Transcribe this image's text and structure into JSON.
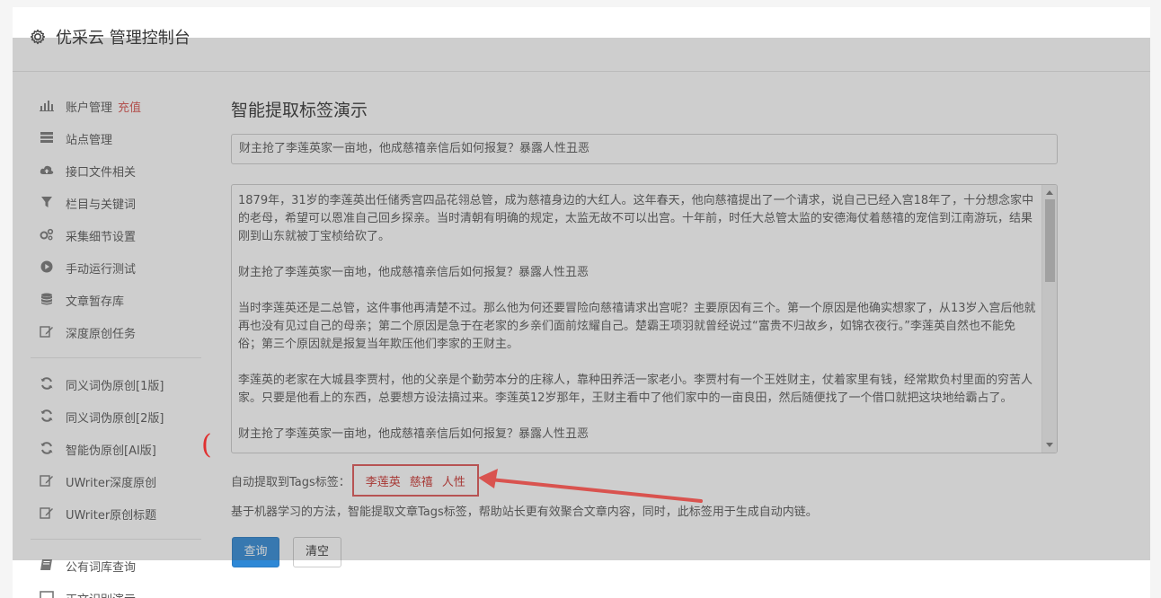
{
  "header": {
    "title": "优采云 管理控制台"
  },
  "sidebar": {
    "items": [
      {
        "label": "账户管理",
        "badge": "充值",
        "icon": "bar-chart-icon"
      },
      {
        "label": "站点管理",
        "icon": "server-icon"
      },
      {
        "label": "接口文件相关",
        "icon": "cloud-upload-icon"
      },
      {
        "label": "栏目与关键词",
        "icon": "filter-icon"
      },
      {
        "label": "采集细节设置",
        "icon": "cogs-icon"
      },
      {
        "label": "手动运行测试",
        "icon": "play-circle-icon"
      },
      {
        "label": "文章暂存库",
        "icon": "database-icon"
      },
      {
        "label": "深度原创任务",
        "icon": "edit-icon"
      }
    ],
    "items2": [
      {
        "label": "同义词伪原创[1版]",
        "icon": "refresh-icon"
      },
      {
        "label": "同义词伪原创[2版]",
        "icon": "refresh-icon"
      },
      {
        "label": "智能伪原创[AI版]",
        "icon": "refresh-icon"
      },
      {
        "label": "UWriter深度原创",
        "icon": "edit-icon"
      },
      {
        "label": "UWriter原创标题",
        "icon": "edit-icon"
      }
    ],
    "items3": [
      {
        "label": "公有词库查询",
        "icon": "book-icon"
      },
      {
        "label": "正文识别演示",
        "icon": "monitor-icon"
      }
    ]
  },
  "main": {
    "page_title": "智能提取标签演示",
    "title_value": "财主抢了李莲英家一亩地，他成慈禧亲信后如何报复？暴露人性丑恶",
    "article_paragraphs": [
      "1879年，31岁的李莲英出任储秀宫四品花翎总管，成为慈禧身边的大红人。这年春天，他向慈禧提出了一个请求，说自己已经入宫18年了，十分想念家中的老母，希望可以恩准自己回乡探亲。当时清朝有明确的规定，太监无故不可以出宫。十年前，时任大总管太监的安德海仗着慈禧的宠信到江南游玩，结果刚到山东就被丁宝桢给砍了。",
      "财主抢了李莲英家一亩地，他成慈禧亲信后如何报复？暴露人性丑恶",
      "当时李莲英还是二总管，这件事他再清楚不过。那么他为何还要冒险向慈禧请求出宫呢？主要原因有三个。第一个原因是他确实想家了，从13岁入宫后他就再也没有见过自己的母亲；第二个原因是急于在老家的乡亲们面前炫耀自己。楚霸王项羽就曾经说过“富贵不归故乡，如锦衣夜行。”李莲英自然也不能免俗；第三个原因就是报复当年欺压他们李家的王财主。",
      "李莲英的老家在大城县李贾村，他的父亲是个勤劳本分的庄稼人，靠种田养活一家老小。李贾村有一个王姓财主，仗着家里有钱，经常欺负村里面的穷苦人家。只要是他看上的东西，总要想方设法搞过来。李莲英12岁那年，王财主看中了他们家中的一亩良田，然后随便找了一个借口就把这块地给霸占了。",
      "财主抢了李莲英家一亩地，他成慈禧亲信后如何报复？暴露人性丑恶"
    ],
    "tags_label": "自动提取到Tags标签：",
    "tags": [
      "李莲英",
      "慈禧",
      "人性"
    ],
    "description": "基于机器学习的方法，智能提取文章Tags标签，帮助站长更有效聚合文章内容，同时，此标签用于生成自动内链。",
    "query_button": "查询",
    "clear_button": "清空"
  },
  "annotation": {
    "paren": "(",
    "color": "#e03030"
  }
}
